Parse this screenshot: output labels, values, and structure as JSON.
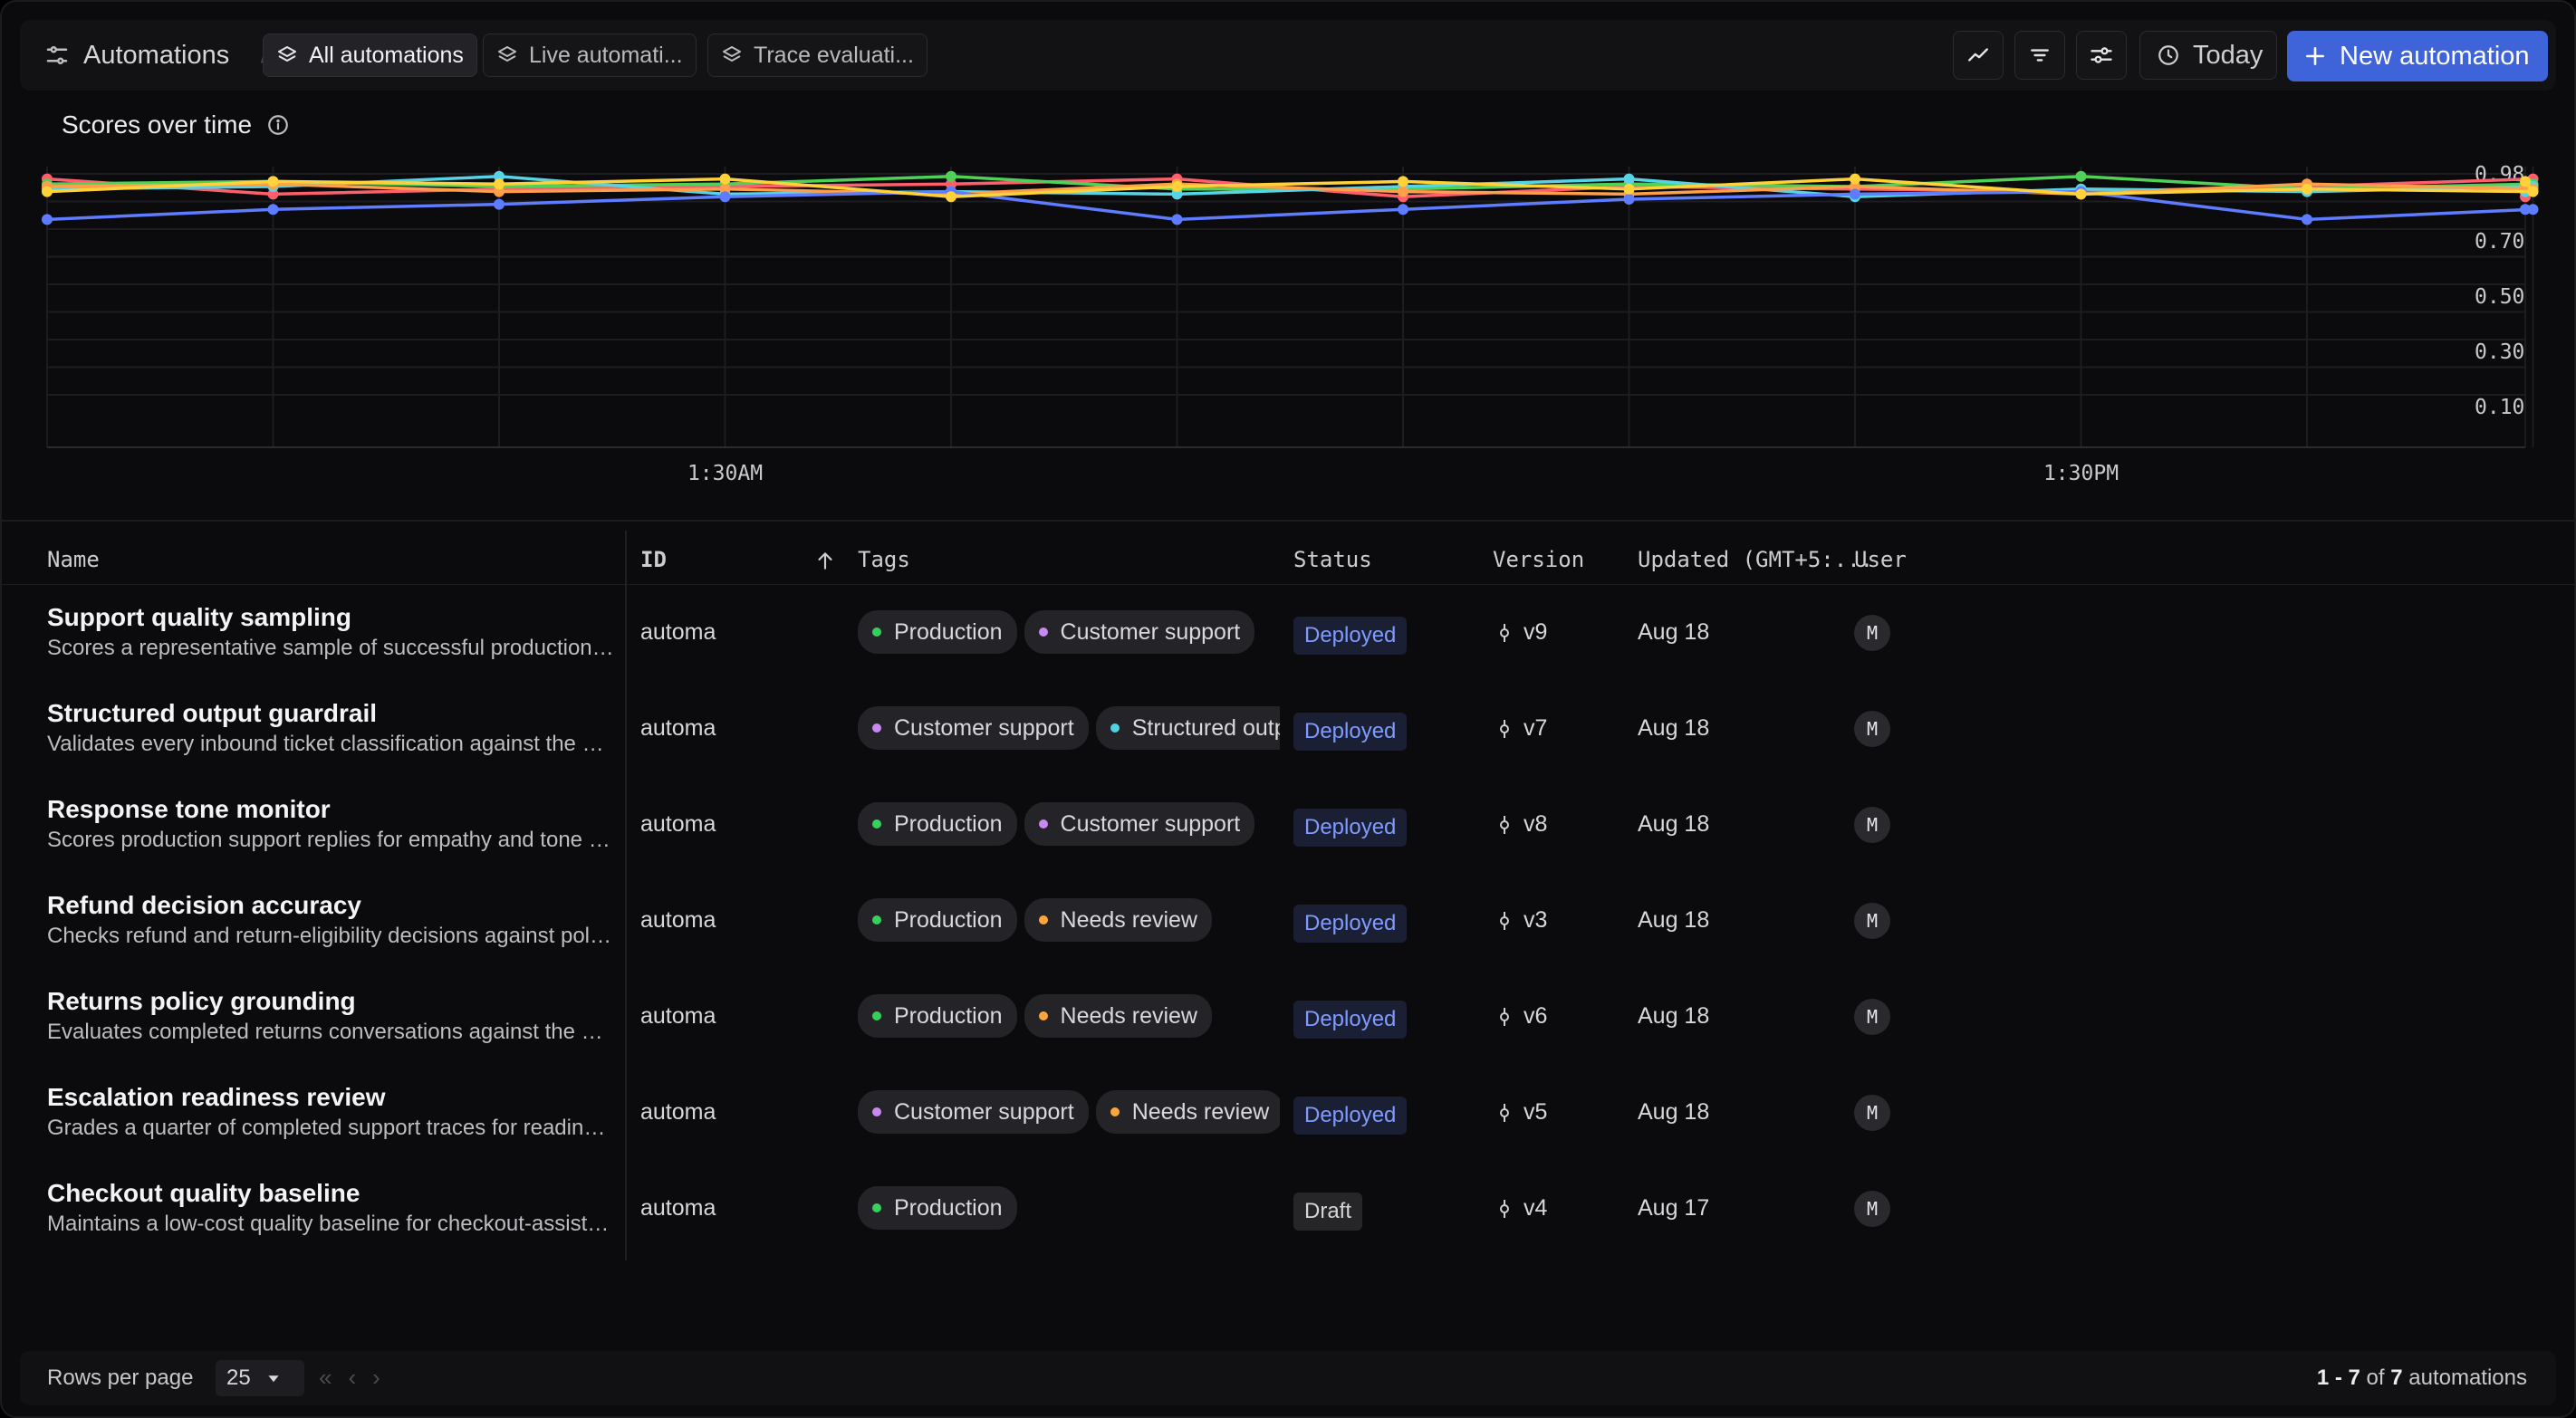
{
  "header": {
    "app_title": "Automations",
    "tabs": [
      {
        "label": "All automations",
        "active": true
      },
      {
        "label": "Live automati...",
        "active": false
      },
      {
        "label": "Trace evaluati...",
        "active": false
      }
    ],
    "today_label": "Today",
    "new_label": "New automation"
  },
  "chart_title": "Scores over time",
  "chart_data": {
    "type": "line",
    "title": "Scores over time",
    "xlabel": "",
    "ylabel": "",
    "x_tick_labels": [
      "1:30AM",
      "1:30PM"
    ],
    "y_tick_labels": [
      "0.98",
      "0.70",
      "0.50",
      "0.30",
      "0.10"
    ],
    "ylim": [
      0,
      1
    ],
    "grid": true,
    "legend": "none",
    "x_count": 12,
    "series": [
      {
        "color": "#ff5f6d",
        "values": [
          0.98,
          0.92,
          0.94,
          0.95,
          0.96,
          0.98,
          0.91,
          0.95,
          0.94,
          0.93,
          0.95,
          0.98
        ],
        "forecast": 0.91
      },
      {
        "color": "#4fd157",
        "values": [
          0.96,
          0.97,
          0.95,
          0.96,
          0.99,
          0.94,
          0.94,
          0.96,
          0.95,
          0.99,
          0.94,
          0.96
        ],
        "forecast": 0.95
      },
      {
        "color": "#56d4e6",
        "values": [
          0.94,
          0.95,
          0.99,
          0.92,
          0.93,
          0.92,
          0.95,
          0.98,
          0.91,
          0.94,
          0.93,
          0.95
        ],
        "forecast": 0.93
      },
      {
        "color": "#ff9f4a",
        "values": [
          0.95,
          0.96,
          0.93,
          0.94,
          0.92,
          0.96,
          0.93,
          0.92,
          0.95,
          0.92,
          0.96,
          0.94
        ],
        "forecast": 0.95
      },
      {
        "color": "#5e7cff",
        "values": [
          0.82,
          0.86,
          0.88,
          0.91,
          0.93,
          0.82,
          0.86,
          0.9,
          0.92,
          0.93,
          0.82,
          0.86
        ],
        "forecast": 0.86
      },
      {
        "color": "#ffd23a",
        "values": [
          0.93,
          0.97,
          0.96,
          0.98,
          0.91,
          0.95,
          0.97,
          0.94,
          0.98,
          0.92,
          0.94,
          0.93
        ],
        "forecast": 0.97
      }
    ]
  },
  "table": {
    "columns": [
      "Name",
      "ID",
      "Tags",
      "Status",
      "Version",
      "Updated (GMT+5:...",
      "User"
    ],
    "rows": [
      {
        "name": "Support quality sampling",
        "desc": "Scores a representative sample of successful production support traces",
        "id": "automa",
        "tags": [
          {
            "label": "Production",
            "color": "#35d15a"
          },
          {
            "label": "Customer support",
            "color": "#c889f2"
          }
        ],
        "status": "Deployed",
        "version": "v9",
        "updated": "Aug 18",
        "user": "M"
      },
      {
        "name": "Structured output guardrail",
        "desc": "Validates every inbound ticket classification against the output schema",
        "id": "automa",
        "tags": [
          {
            "label": "Customer support",
            "color": "#c889f2"
          },
          {
            "label": "Structured output",
            "color": "#4fd3e0"
          }
        ],
        "status": "Deployed",
        "version": "v7",
        "updated": "Aug 18",
        "user": "M"
      },
      {
        "name": "Response tone monitor",
        "desc": "Scores production support replies for empathy and tone consistency",
        "id": "automa",
        "tags": [
          {
            "label": "Production",
            "color": "#35d15a"
          },
          {
            "label": "Customer support",
            "color": "#c889f2"
          }
        ],
        "status": "Deployed",
        "version": "v8",
        "updated": "Aug 18",
        "user": "M"
      },
      {
        "name": "Refund decision accuracy",
        "desc": "Checks refund and return-eligibility decisions against policy rules",
        "id": "automa",
        "tags": [
          {
            "label": "Production",
            "color": "#35d15a"
          },
          {
            "label": "Needs review",
            "color": "#ffa53b"
          }
        ],
        "status": "Deployed",
        "version": "v3",
        "updated": "Aug 18",
        "user": "M"
      },
      {
        "name": "Returns policy grounding",
        "desc": "Evaluates completed returns conversations against the policy documents",
        "id": "automa",
        "tags": [
          {
            "label": "Production",
            "color": "#35d15a"
          },
          {
            "label": "Needs review",
            "color": "#ffa53b"
          }
        ],
        "status": "Deployed",
        "version": "v6",
        "updated": "Aug 18",
        "user": "M"
      },
      {
        "name": "Escalation readiness review",
        "desc": "Grades a quarter of completed support traces for readiness to escalate",
        "id": "automa",
        "tags": [
          {
            "label": "Customer support",
            "color": "#c889f2"
          },
          {
            "label": "Needs review",
            "color": "#ffa53b"
          }
        ],
        "status": "Deployed",
        "version": "v5",
        "updated": "Aug 18",
        "user": "M"
      },
      {
        "name": "Checkout quality baseline",
        "desc": "Maintains a low-cost quality baseline for checkout-assistant traces",
        "id": "automa",
        "tags": [
          {
            "label": "Production",
            "color": "#35d15a"
          }
        ],
        "status": "Draft",
        "version": "v4",
        "updated": "Aug 17",
        "user": "M"
      }
    ]
  },
  "footer": {
    "rows_label": "Rows per page",
    "rows_value": "25",
    "range_text": "1 - 7",
    "of_text": "of",
    "total": "7",
    "suffix": "automations"
  }
}
